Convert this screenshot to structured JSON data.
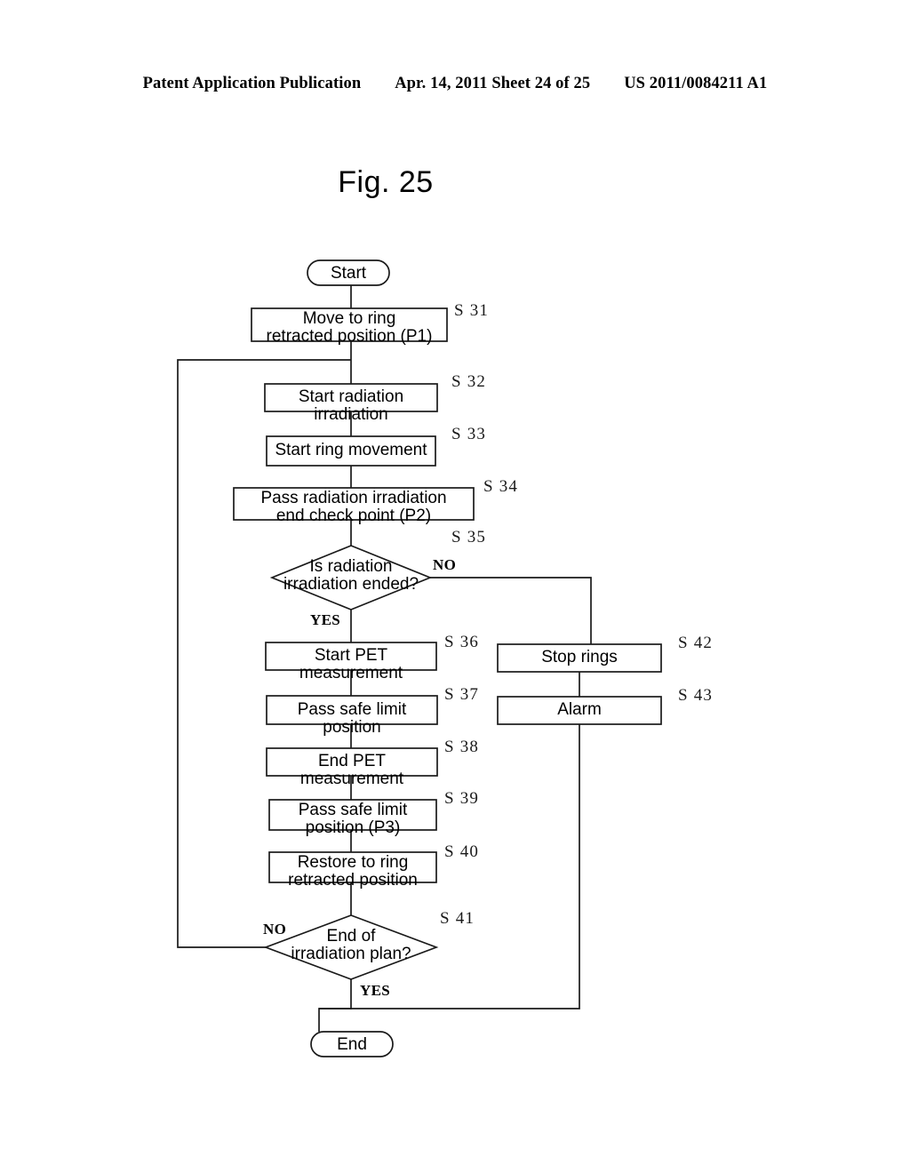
{
  "header": {
    "left": "Patent Application Publication",
    "middle": "Apr. 14, 2011  Sheet 24 of 25",
    "right": "US 2011/0084211 A1"
  },
  "figure": {
    "title": "Fig. 25"
  },
  "flowchart": {
    "type": "flowchart",
    "start_label": "Start",
    "end_label": "End",
    "nodes": [
      {
        "id": "start",
        "shape": "terminator",
        "text": "Start",
        "step": ""
      },
      {
        "id": "s31",
        "shape": "process",
        "text": "Move to ring\nretracted position (P1)",
        "step": "S 31"
      },
      {
        "id": "s32",
        "shape": "process",
        "text": "Start radiation irradiation",
        "step": "S 32"
      },
      {
        "id": "s33",
        "shape": "process",
        "text": "Start ring movement",
        "step": "S 33"
      },
      {
        "id": "s34",
        "shape": "process",
        "text": "Pass radiation irradiation\nend check point (P2)",
        "step": "S 34"
      },
      {
        "id": "s35",
        "shape": "decision",
        "text": "Is radiation\nirradiation ended?",
        "step": "S 35"
      },
      {
        "id": "s36",
        "shape": "process",
        "text": "Start PET measurement",
        "step": "S 36"
      },
      {
        "id": "s37",
        "shape": "process",
        "text": "Pass safe limit position",
        "step": "S 37"
      },
      {
        "id": "s38",
        "shape": "process",
        "text": "End PET measurement",
        "step": "S 38"
      },
      {
        "id": "s39",
        "shape": "process",
        "text": "Pass safe limit\nposition (P3)",
        "step": "S 39"
      },
      {
        "id": "s40",
        "shape": "process",
        "text": "Restore to ring\nretracted position",
        "step": "S 40"
      },
      {
        "id": "s41",
        "shape": "decision",
        "text": "End of\nirradiation plan?",
        "step": "S 41"
      },
      {
        "id": "s42",
        "shape": "process",
        "text": "Stop rings",
        "step": "S 42"
      },
      {
        "id": "s43",
        "shape": "process",
        "text": "Alarm",
        "step": "S 43"
      },
      {
        "id": "end",
        "shape": "terminator",
        "text": "End",
        "step": ""
      }
    ],
    "branch_labels": {
      "s35_no": "NO",
      "s35_yes": "YES",
      "s41_no": "NO",
      "s41_yes": "YES"
    },
    "line_color": "#1a1a1a"
  }
}
